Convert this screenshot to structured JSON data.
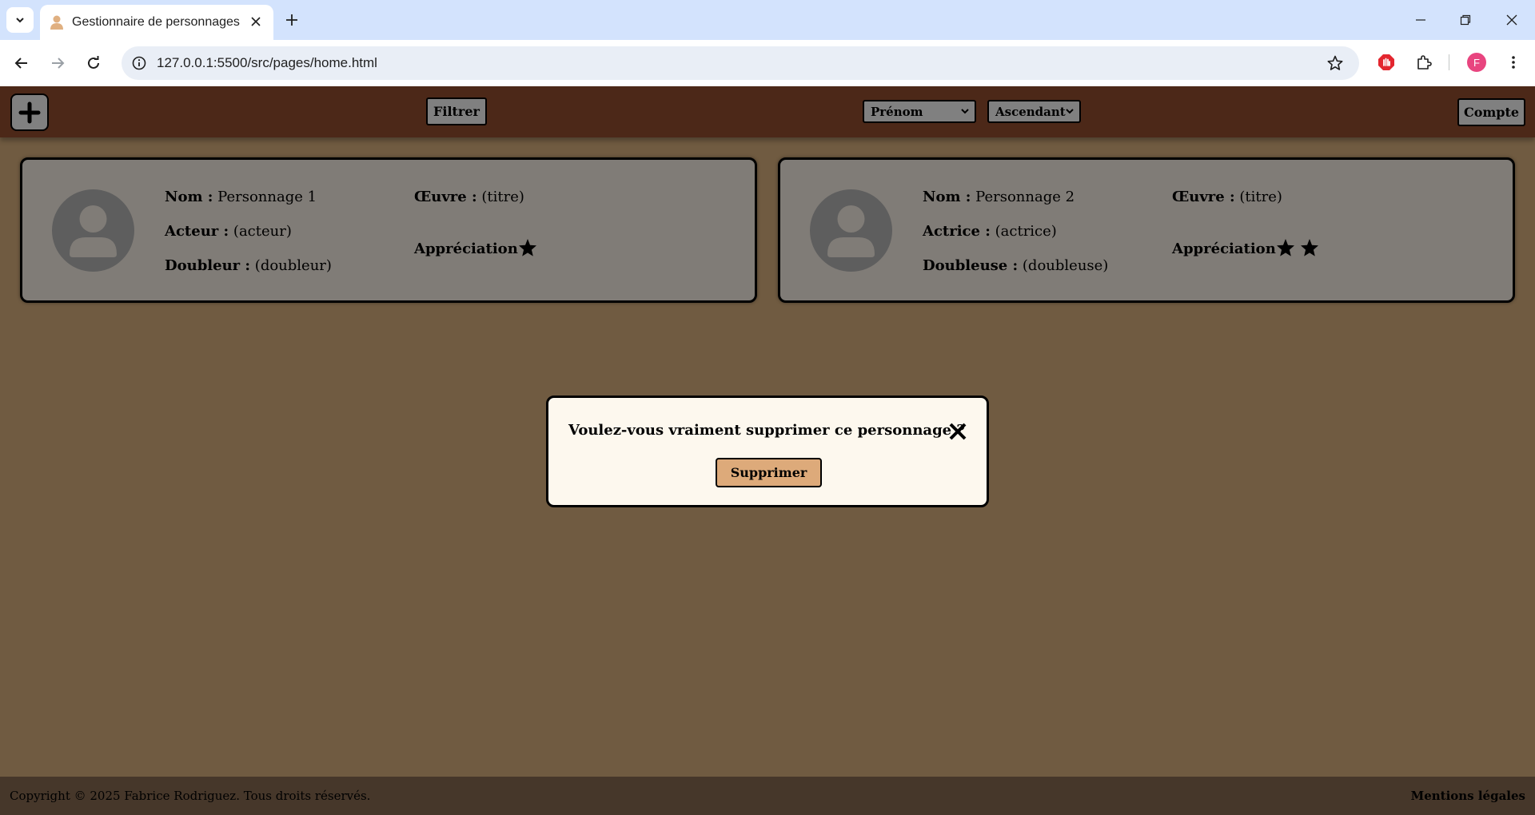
{
  "browser": {
    "tab_title": "Gestionnaire de personnages",
    "url": "127.0.0.1:5500/src/pages/home.html",
    "profile_initial": "F"
  },
  "header": {
    "filter_label": "Filtrer",
    "sort_field": "Prénom",
    "sort_order": "Ascendant",
    "account_label": "Compte"
  },
  "cards": [
    {
      "name_label": "Nom :",
      "name": "Personnage 1",
      "actor_label": "Acteur :",
      "actor": "(acteur)",
      "voice_label": "Doubleur :",
      "voice": "(doubleur)",
      "work_label": "Œuvre :",
      "work": "(titre)",
      "rating_label": "Appréciation :",
      "rating": 1
    },
    {
      "name_label": "Nom :",
      "name": "Personnage 2",
      "actor_label": "Actrice :",
      "actor": "(actrice)",
      "voice_label": "Doubleuse :",
      "voice": "(doubleuse)",
      "work_label": "Œuvre :",
      "work": "(titre)",
      "rating_label": "Appréciation :",
      "rating": 2
    }
  ],
  "modal": {
    "message": "Voulez-vous vraiment supprimer ce personnage ?",
    "delete_label": "Supprimer"
  },
  "footer": {
    "copyright": "Copyright © 2025 Fabrice Rodriguez. Tous droits réservés.",
    "legal": "Mentions légales"
  },
  "colors": {
    "header": "#4c2818",
    "page": "#705b41",
    "card": "#807c77",
    "modal": "#fdf8ee",
    "delete_button": "#ddaa7a",
    "footer": "#46372a"
  }
}
